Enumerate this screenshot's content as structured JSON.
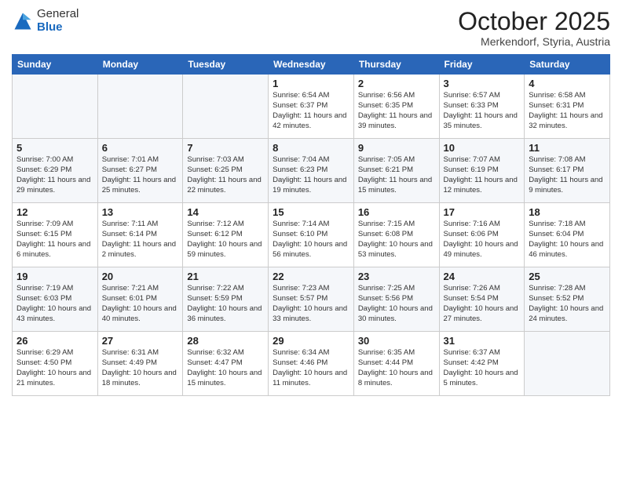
{
  "logo": {
    "general": "General",
    "blue": "Blue"
  },
  "header": {
    "month": "October 2025",
    "location": "Merkendorf, Styria, Austria"
  },
  "weekdays": [
    "Sunday",
    "Monday",
    "Tuesday",
    "Wednesday",
    "Thursday",
    "Friday",
    "Saturday"
  ],
  "weeks": [
    [
      {
        "day": "",
        "info": ""
      },
      {
        "day": "",
        "info": ""
      },
      {
        "day": "",
        "info": ""
      },
      {
        "day": "1",
        "info": "Sunrise: 6:54 AM\nSunset: 6:37 PM\nDaylight: 11 hours\nand 42 minutes."
      },
      {
        "day": "2",
        "info": "Sunrise: 6:56 AM\nSunset: 6:35 PM\nDaylight: 11 hours\nand 39 minutes."
      },
      {
        "day": "3",
        "info": "Sunrise: 6:57 AM\nSunset: 6:33 PM\nDaylight: 11 hours\nand 35 minutes."
      },
      {
        "day": "4",
        "info": "Sunrise: 6:58 AM\nSunset: 6:31 PM\nDaylight: 11 hours\nand 32 minutes."
      }
    ],
    [
      {
        "day": "5",
        "info": "Sunrise: 7:00 AM\nSunset: 6:29 PM\nDaylight: 11 hours\nand 29 minutes."
      },
      {
        "day": "6",
        "info": "Sunrise: 7:01 AM\nSunset: 6:27 PM\nDaylight: 11 hours\nand 25 minutes."
      },
      {
        "day": "7",
        "info": "Sunrise: 7:03 AM\nSunset: 6:25 PM\nDaylight: 11 hours\nand 22 minutes."
      },
      {
        "day": "8",
        "info": "Sunrise: 7:04 AM\nSunset: 6:23 PM\nDaylight: 11 hours\nand 19 minutes."
      },
      {
        "day": "9",
        "info": "Sunrise: 7:05 AM\nSunset: 6:21 PM\nDaylight: 11 hours\nand 15 minutes."
      },
      {
        "day": "10",
        "info": "Sunrise: 7:07 AM\nSunset: 6:19 PM\nDaylight: 11 hours\nand 12 minutes."
      },
      {
        "day": "11",
        "info": "Sunrise: 7:08 AM\nSunset: 6:17 PM\nDaylight: 11 hours\nand 9 minutes."
      }
    ],
    [
      {
        "day": "12",
        "info": "Sunrise: 7:09 AM\nSunset: 6:15 PM\nDaylight: 11 hours\nand 6 minutes."
      },
      {
        "day": "13",
        "info": "Sunrise: 7:11 AM\nSunset: 6:14 PM\nDaylight: 11 hours\nand 2 minutes."
      },
      {
        "day": "14",
        "info": "Sunrise: 7:12 AM\nSunset: 6:12 PM\nDaylight: 10 hours\nand 59 minutes."
      },
      {
        "day": "15",
        "info": "Sunrise: 7:14 AM\nSunset: 6:10 PM\nDaylight: 10 hours\nand 56 minutes."
      },
      {
        "day": "16",
        "info": "Sunrise: 7:15 AM\nSunset: 6:08 PM\nDaylight: 10 hours\nand 53 minutes."
      },
      {
        "day": "17",
        "info": "Sunrise: 7:16 AM\nSunset: 6:06 PM\nDaylight: 10 hours\nand 49 minutes."
      },
      {
        "day": "18",
        "info": "Sunrise: 7:18 AM\nSunset: 6:04 PM\nDaylight: 10 hours\nand 46 minutes."
      }
    ],
    [
      {
        "day": "19",
        "info": "Sunrise: 7:19 AM\nSunset: 6:03 PM\nDaylight: 10 hours\nand 43 minutes."
      },
      {
        "day": "20",
        "info": "Sunrise: 7:21 AM\nSunset: 6:01 PM\nDaylight: 10 hours\nand 40 minutes."
      },
      {
        "day": "21",
        "info": "Sunrise: 7:22 AM\nSunset: 5:59 PM\nDaylight: 10 hours\nand 36 minutes."
      },
      {
        "day": "22",
        "info": "Sunrise: 7:23 AM\nSunset: 5:57 PM\nDaylight: 10 hours\nand 33 minutes."
      },
      {
        "day": "23",
        "info": "Sunrise: 7:25 AM\nSunset: 5:56 PM\nDaylight: 10 hours\nand 30 minutes."
      },
      {
        "day": "24",
        "info": "Sunrise: 7:26 AM\nSunset: 5:54 PM\nDaylight: 10 hours\nand 27 minutes."
      },
      {
        "day": "25",
        "info": "Sunrise: 7:28 AM\nSunset: 5:52 PM\nDaylight: 10 hours\nand 24 minutes."
      }
    ],
    [
      {
        "day": "26",
        "info": "Sunrise: 6:29 AM\nSunset: 4:50 PM\nDaylight: 10 hours\nand 21 minutes."
      },
      {
        "day": "27",
        "info": "Sunrise: 6:31 AM\nSunset: 4:49 PM\nDaylight: 10 hours\nand 18 minutes."
      },
      {
        "day": "28",
        "info": "Sunrise: 6:32 AM\nSunset: 4:47 PM\nDaylight: 10 hours\nand 15 minutes."
      },
      {
        "day": "29",
        "info": "Sunrise: 6:34 AM\nSunset: 4:46 PM\nDaylight: 10 hours\nand 11 minutes."
      },
      {
        "day": "30",
        "info": "Sunrise: 6:35 AM\nSunset: 4:44 PM\nDaylight: 10 hours\nand 8 minutes."
      },
      {
        "day": "31",
        "info": "Sunrise: 6:37 AM\nSunset: 4:42 PM\nDaylight: 10 hours\nand 5 minutes."
      },
      {
        "day": "",
        "info": ""
      }
    ]
  ]
}
